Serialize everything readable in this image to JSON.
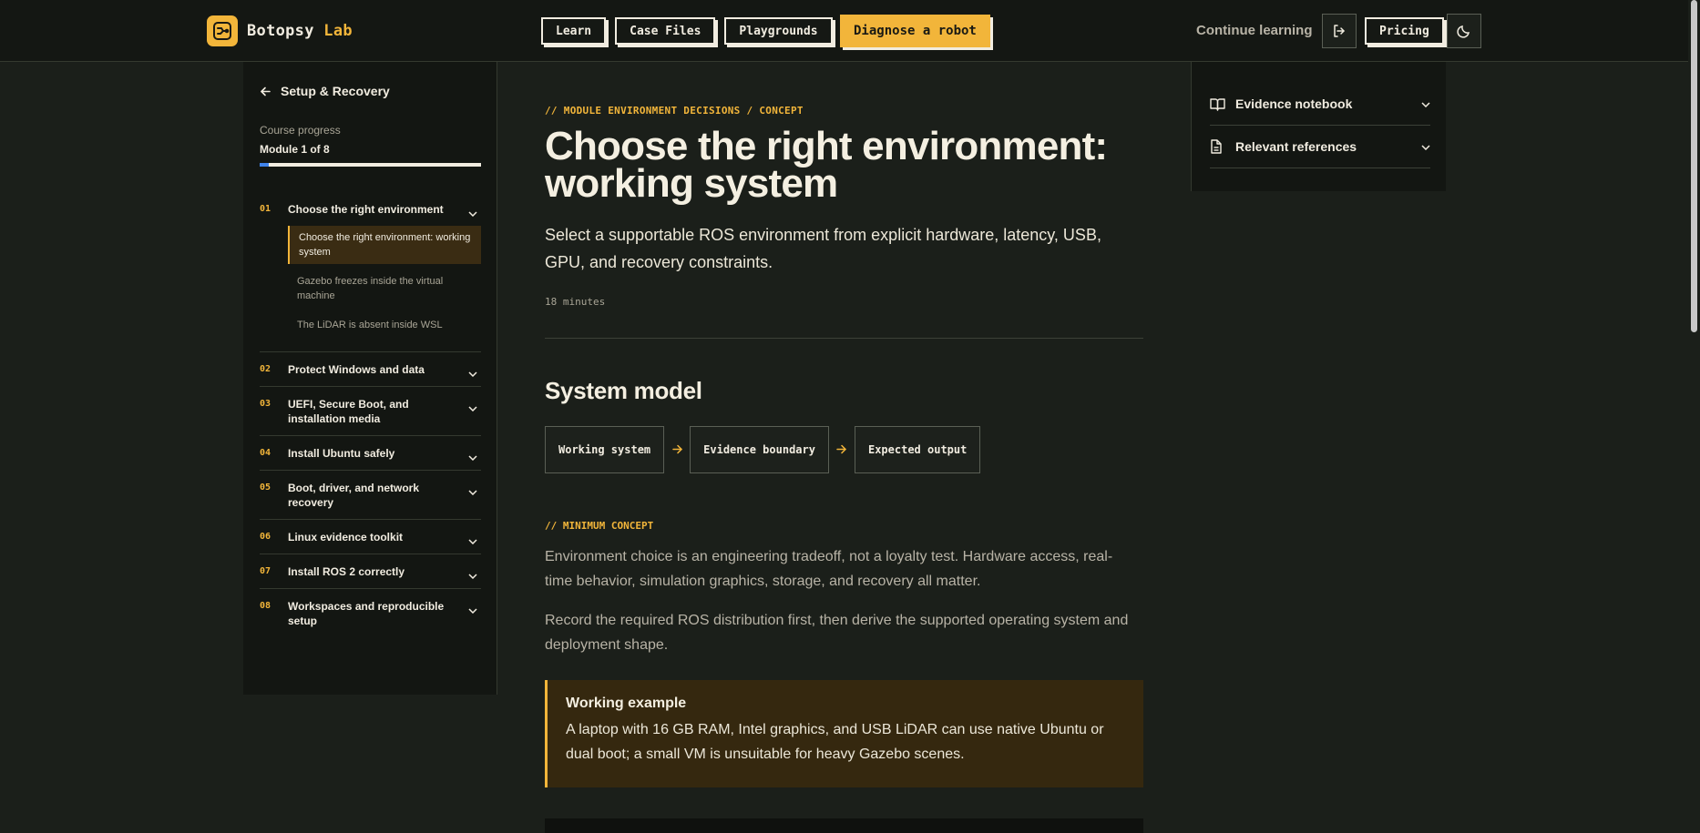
{
  "header": {
    "logo_name": "Botopsy",
    "logo_accent": "Lab",
    "nav": [
      "Learn",
      "Case Files",
      "Playgrounds"
    ],
    "cta": "Diagnose a robot",
    "continue_label": "Continue learning",
    "pricing_label": "Pricing",
    "logout_icon": "logout-icon",
    "theme_icon": "moon-icon"
  },
  "sidebar": {
    "back_label": "Setup & Recovery",
    "progress_label": "Course progress",
    "progress_value": "Module 1 of 8",
    "progress_fraction": 0.04,
    "modules": [
      {
        "num": "01",
        "title": "Choose the right environment",
        "lessons": [
          "Choose the right environment: working system",
          "Gazebo freezes inside the virtual machine",
          "The LiDAR is absent inside WSL"
        ]
      },
      {
        "num": "02",
        "title": "Protect Windows and data"
      },
      {
        "num": "03",
        "title": "UEFI, Secure Boot, and installation media"
      },
      {
        "num": "04",
        "title": "Install Ubuntu safely"
      },
      {
        "num": "05",
        "title": "Boot, driver, and network recovery"
      },
      {
        "num": "06",
        "title": "Linux evidence toolkit"
      },
      {
        "num": "07",
        "title": "Install ROS 2 correctly"
      },
      {
        "num": "08",
        "title": "Workspaces and reproducible setup"
      }
    ]
  },
  "main": {
    "eyebrow": "// MODULE ENVIRONMENT DECISIONS / CONCEPT",
    "title": "Choose the right environment: working system",
    "lede": "Select a supportable ROS environment from explicit hardware, latency, USB, GPU, and recovery constraints.",
    "duration": "18 minutes",
    "section_title": "System model",
    "flow": [
      "Working system",
      "Evidence boundary",
      "Expected output"
    ],
    "concept_eyebrow": "// MINIMUM CONCEPT",
    "para1": "Environment choice is an engineering tradeoff, not a loyalty test. Hardware access, real-time behavior, simulation graphics, storage, and recovery all matter.",
    "para2": "Record the required ROS distribution first, then derive the supported operating system and deployment shape.",
    "callout_title": "Working example",
    "callout_body": "A laptop with 16 GB RAM, Intel graphics, and USB LiDAR can use native Ubuntu or dual boot; a small VM is unsuitable for heavy Gazebo scenes."
  },
  "right": {
    "items": [
      {
        "label": "Evidence notebook",
        "icon": "book-icon"
      },
      {
        "label": "Relevant references",
        "icon": "document-icon"
      }
    ]
  },
  "colors": {
    "accent": "#f2b53a",
    "background": "#1b1f1a",
    "progress": "#3f83ea"
  }
}
